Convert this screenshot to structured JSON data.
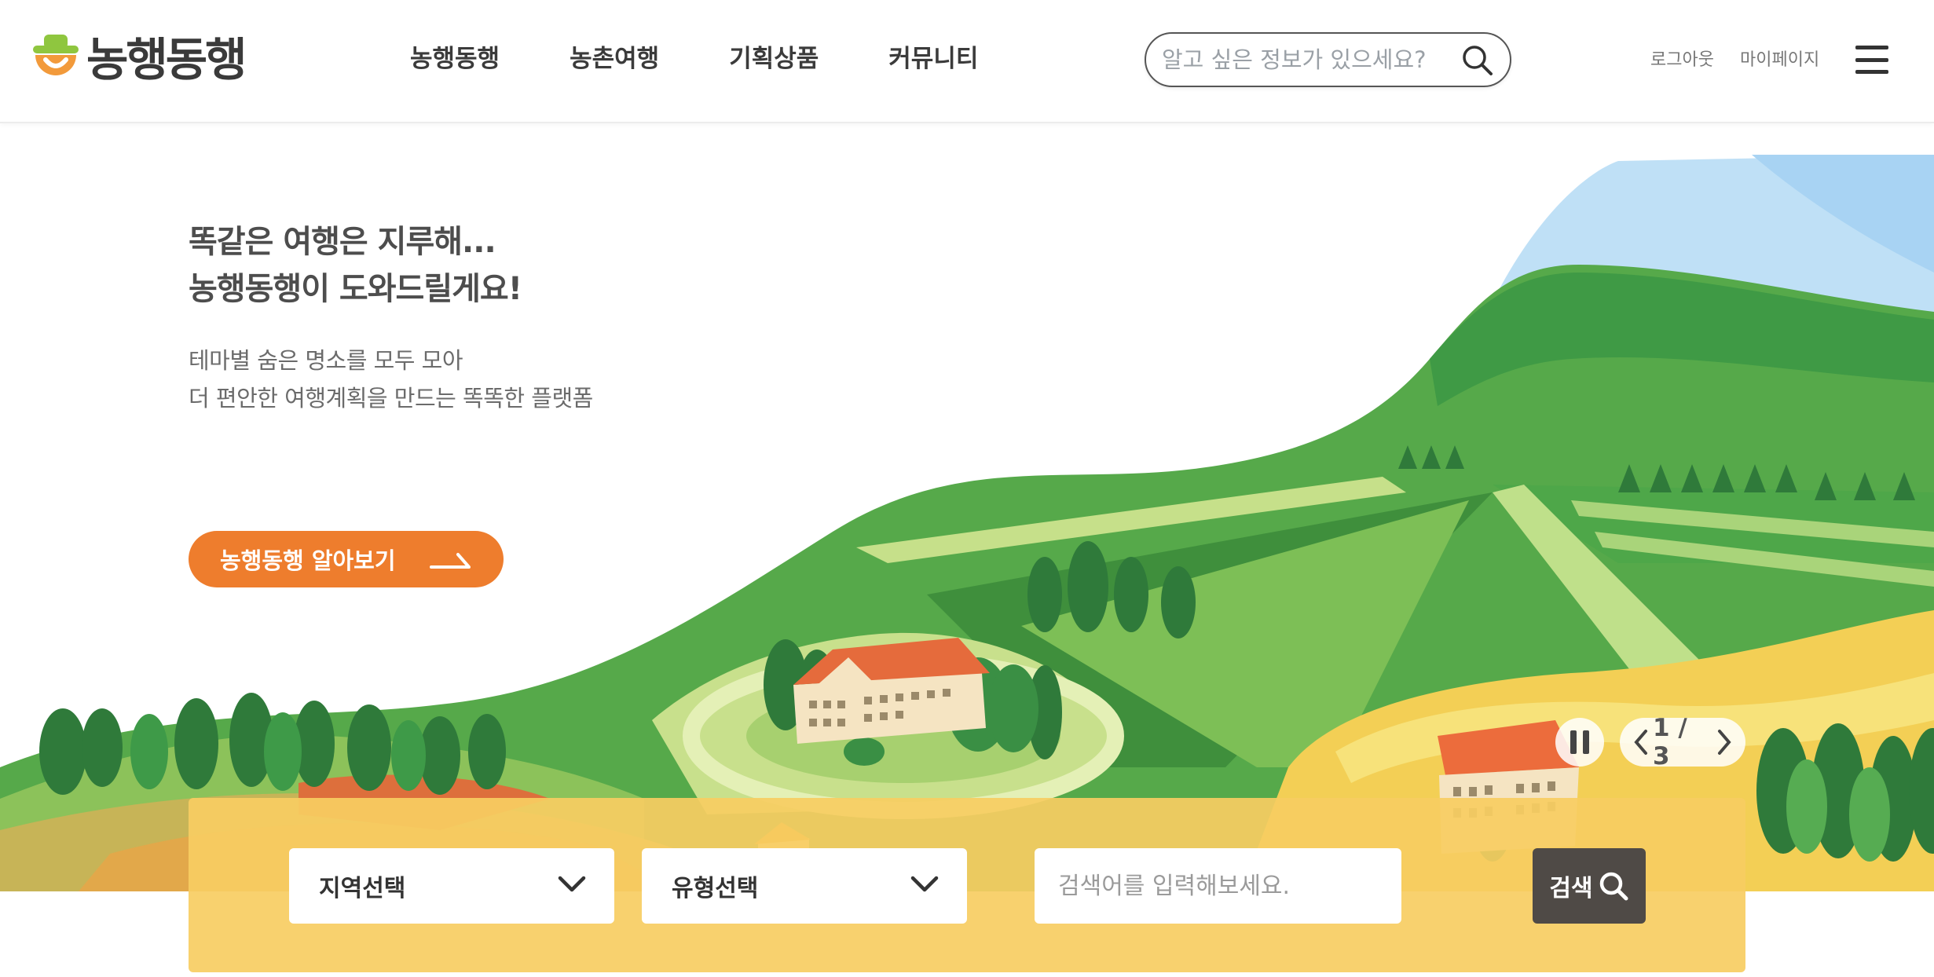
{
  "logo": {
    "text": "농행동행",
    "icon": "smiley-hat-logo"
  },
  "nav": {
    "items": [
      {
        "label": "농행동행"
      },
      {
        "label": "농촌여행"
      },
      {
        "label": "기획상품"
      },
      {
        "label": "커뮤니티"
      }
    ]
  },
  "search": {
    "placeholder": "알고 싶은 정보가 있으세요?",
    "icon": "search-icon"
  },
  "util": {
    "logout": "로그아웃",
    "mypage": "마이페이지",
    "menu_icon": "hamburger-menu-icon"
  },
  "hero": {
    "title_line1": "똑같은 여행은 지루해...",
    "title_line2": "농행동행이 도와드릴게요!",
    "sub_line1": "테마별 숨은 명소를 모두 모아",
    "sub_line2": "더 편안한 여행계획을 만드는 똑똑한 플랫폼",
    "cta_label": "농행동행 알아보기"
  },
  "slider": {
    "current": 1,
    "total": 3,
    "label": "1 / 3"
  },
  "finder": {
    "region_label": "지역선택",
    "type_label": "유형선택",
    "keyword_placeholder": "검색어를 입력해보세요.",
    "submit_label": "검색"
  },
  "colors": {
    "accent": "#ee7d2d",
    "panel": "#f7cd62",
    "button_dark": "#4f4a46",
    "green": "#3f9a45"
  }
}
